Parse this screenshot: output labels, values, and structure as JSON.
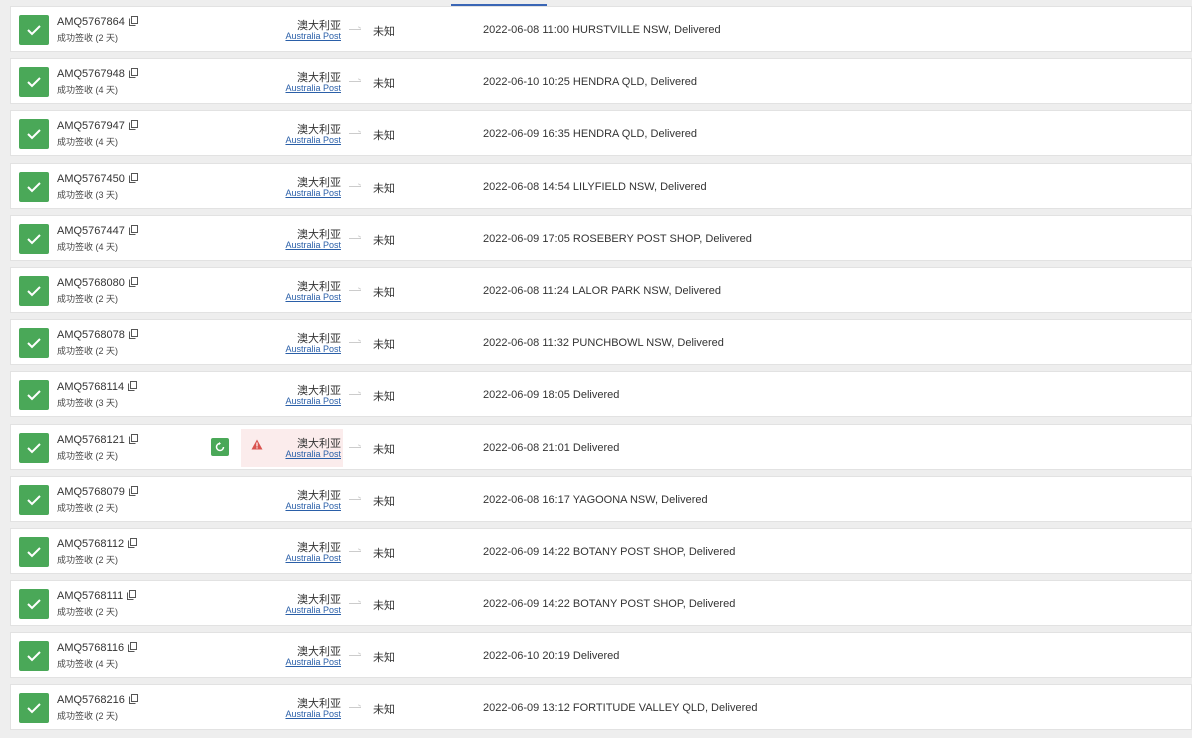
{
  "colors": {
    "check_green": "#4aa858",
    "link_blue": "#2a5fa8",
    "warning_red": "#d9534f",
    "warning_bg": "#fbecec"
  },
  "shipments": [
    {
      "tracking": "AMQ5767864",
      "status": "成功签收 (2 天)",
      "country": "澳大利亚",
      "carrier": "Australia Post",
      "destination": "未知",
      "event": "2022-06-08 11:00  HURSTVILLE NSW, Delivered",
      "warning": false
    },
    {
      "tracking": "AMQ5767948",
      "status": "成功签收 (4 天)",
      "country": "澳大利亚",
      "carrier": "Australia Post",
      "destination": "未知",
      "event": "2022-06-10 10:25  HENDRA QLD, Delivered",
      "warning": false
    },
    {
      "tracking": "AMQ5767947",
      "status": "成功签收 (4 天)",
      "country": "澳大利亚",
      "carrier": "Australia Post",
      "destination": "未知",
      "event": "2022-06-09 16:35  HENDRA QLD, Delivered",
      "warning": false
    },
    {
      "tracking": "AMQ5767450",
      "status": "成功签收 (3 天)",
      "country": "澳大利亚",
      "carrier": "Australia Post",
      "destination": "未知",
      "event": "2022-06-08 14:54  LILYFIELD NSW, Delivered",
      "warning": false
    },
    {
      "tracking": "AMQ5767447",
      "status": "成功签收 (4 天)",
      "country": "澳大利亚",
      "carrier": "Australia Post",
      "destination": "未知",
      "event": "2022-06-09 17:05  ROSEBERY POST SHOP, Delivered",
      "warning": false
    },
    {
      "tracking": "AMQ5768080",
      "status": "成功签收 (2 天)",
      "country": "澳大利亚",
      "carrier": "Australia Post",
      "destination": "未知",
      "event": "2022-06-08 11:24  LALOR PARK NSW, Delivered",
      "warning": false
    },
    {
      "tracking": "AMQ5768078",
      "status": "成功签收 (2 天)",
      "country": "澳大利亚",
      "carrier": "Australia Post",
      "destination": "未知",
      "event": "2022-06-08 11:32  PUNCHBOWL NSW, Delivered",
      "warning": false
    },
    {
      "tracking": "AMQ5768114",
      "status": "成功签收 (3 天)",
      "country": "澳大利亚",
      "carrier": "Australia Post",
      "destination": "未知",
      "event": "2022-06-09 18:05  Delivered",
      "warning": false
    },
    {
      "tracking": "AMQ5768121",
      "status": "成功签收 (2 天)",
      "country": "澳大利亚",
      "carrier": "Australia Post",
      "destination": "未知",
      "event": "2022-06-08 21:01  Delivered",
      "warning": true
    },
    {
      "tracking": "AMQ5768079",
      "status": "成功签收 (2 天)",
      "country": "澳大利亚",
      "carrier": "Australia Post",
      "destination": "未知",
      "event": "2022-06-08 16:17  YAGOONA NSW, Delivered",
      "warning": false
    },
    {
      "tracking": "AMQ5768112",
      "status": "成功签收 (2 天)",
      "country": "澳大利亚",
      "carrier": "Australia Post",
      "destination": "未知",
      "event": "2022-06-09 14:22  BOTANY POST SHOP, Delivered",
      "warning": false
    },
    {
      "tracking": "AMQ5768111",
      "status": "成功签收 (2 天)",
      "country": "澳大利亚",
      "carrier": "Australia Post",
      "destination": "未知",
      "event": "2022-06-09 14:22  BOTANY POST SHOP, Delivered",
      "warning": false
    },
    {
      "tracking": "AMQ5768116",
      "status": "成功签收 (4 天)",
      "country": "澳大利亚",
      "carrier": "Australia Post",
      "destination": "未知",
      "event": "2022-06-10 20:19  Delivered",
      "warning": false
    },
    {
      "tracking": "AMQ5768216",
      "status": "成功签收 (2 天)",
      "country": "澳大利亚",
      "carrier": "Australia Post",
      "destination": "未知",
      "event": "2022-06-09 13:12  FORTITUDE VALLEY QLD, Delivered",
      "warning": false
    }
  ]
}
